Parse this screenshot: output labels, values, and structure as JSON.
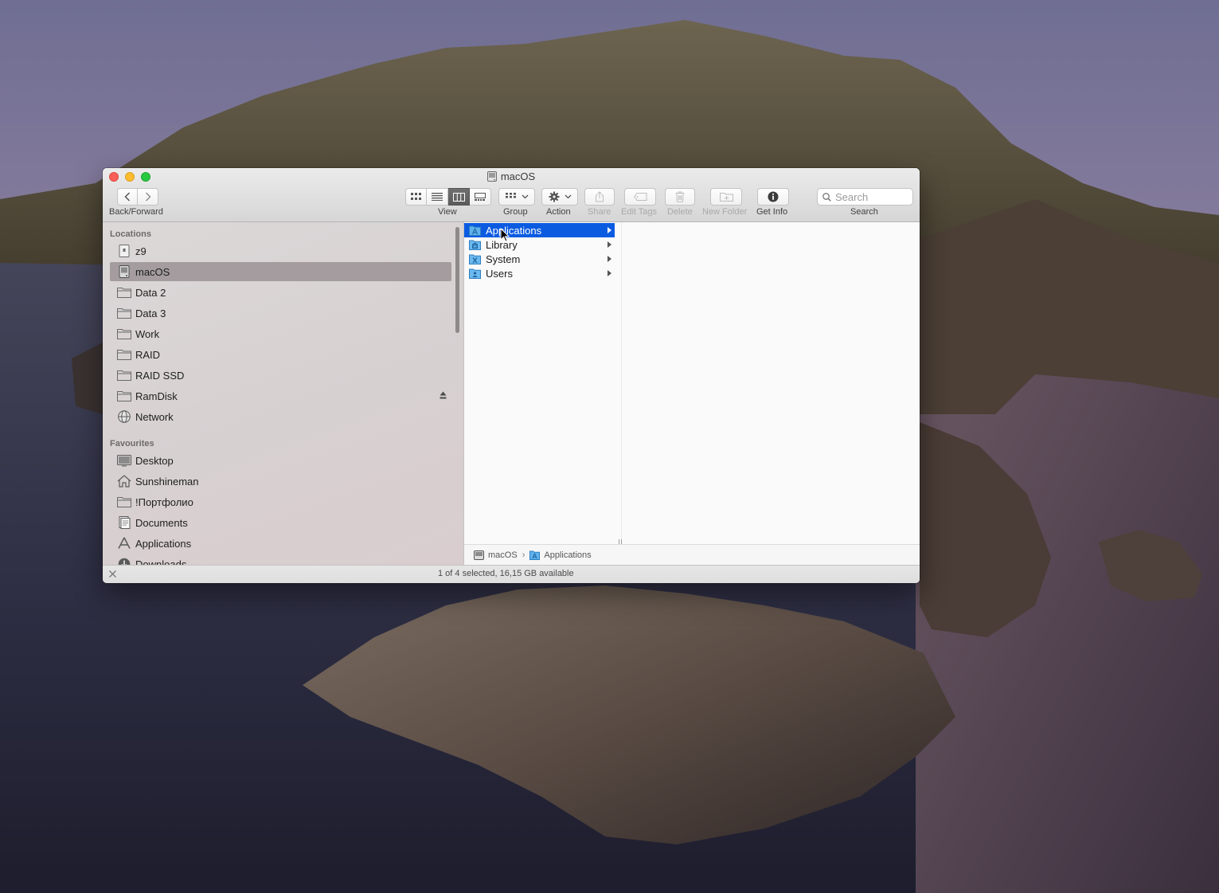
{
  "window": {
    "title": "macOS"
  },
  "toolbar": {
    "back_forward_label": "Back/Forward",
    "view_label": "View",
    "group_label": "Group",
    "action_label": "Action",
    "share_label": "Share",
    "edit_tags_label": "Edit Tags",
    "delete_label": "Delete",
    "new_folder_label": "New Folder",
    "get_info_label": "Get Info",
    "search_label": "Search",
    "search_placeholder": "Search",
    "active_view": "columns"
  },
  "sidebar": {
    "locations_header": "Locations",
    "locations": [
      {
        "label": "z9",
        "icon": "drive-icon"
      },
      {
        "label": "macOS",
        "icon": "internal-drive-icon",
        "selected": true
      },
      {
        "label": "Data 2",
        "icon": "folder-icon"
      },
      {
        "label": "Data 3",
        "icon": "folder-icon"
      },
      {
        "label": "Work",
        "icon": "folder-icon"
      },
      {
        "label": "RAID",
        "icon": "folder-icon"
      },
      {
        "label": "RAID SSD",
        "icon": "folder-icon"
      },
      {
        "label": "RamDisk",
        "icon": "folder-icon",
        "ejectable": true
      },
      {
        "label": "Network",
        "icon": "network-globe-icon"
      }
    ],
    "favourites_header": "Favourites",
    "favourites": [
      {
        "label": "Desktop",
        "icon": "desktop-icon"
      },
      {
        "label": "Sunshineman",
        "icon": "home-icon"
      },
      {
        "label": "!Портфолио",
        "icon": "folder-icon"
      },
      {
        "label": "Documents",
        "icon": "documents-icon"
      },
      {
        "label": "Applications",
        "icon": "applications-icon"
      },
      {
        "label": "Downloads",
        "icon": "downloads-icon"
      }
    ]
  },
  "column": {
    "items": [
      {
        "label": "Applications",
        "icon": "applications-folder-icon",
        "selected": true
      },
      {
        "label": "Library",
        "icon": "library-folder-icon"
      },
      {
        "label": "System",
        "icon": "system-folder-icon"
      },
      {
        "label": "Users",
        "icon": "users-folder-icon"
      }
    ]
  },
  "pathbar": {
    "segments": [
      "macOS",
      "Applications"
    ]
  },
  "status": {
    "text": "1 of 4 selected, 16,15 GB available"
  },
  "colors": {
    "selection_blue": "#0b5be1",
    "sidebar_selected": "#a49c9e",
    "close": "#fc5f57",
    "minimize": "#fdbc2e",
    "zoom": "#28c840"
  }
}
